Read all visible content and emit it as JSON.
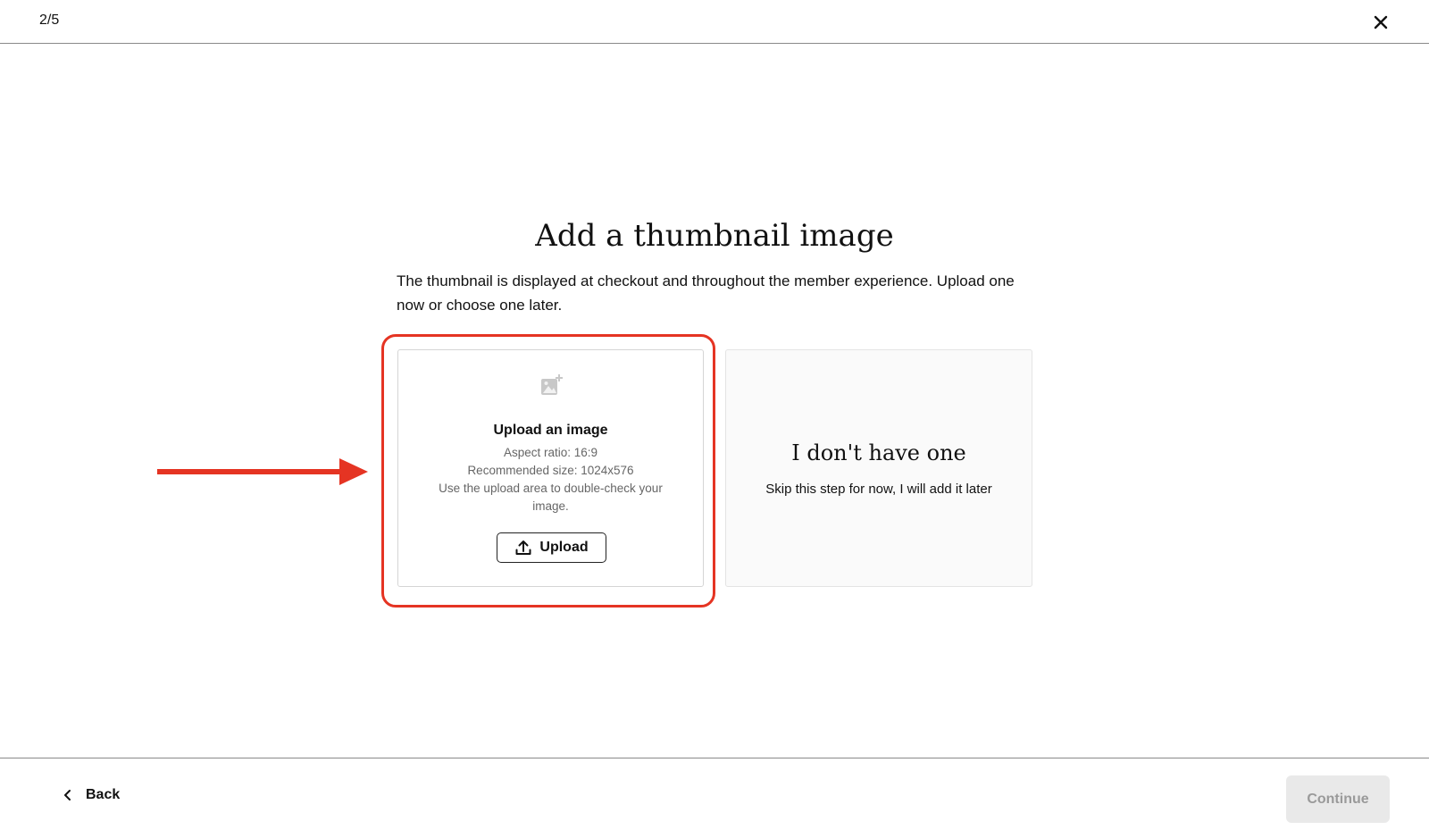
{
  "header": {
    "step_indicator": "2/5",
    "close_icon": "close-icon"
  },
  "main": {
    "title": "Add a thumbnail image",
    "description": "The thumbnail is displayed at checkout and throughout the member experience. Upload one now or choose one later."
  },
  "upload_card": {
    "icon": "image-add-icon",
    "title": "Upload an image",
    "aspect_ratio": "Aspect ratio: 16:9",
    "recommended_size": "Recommended size: 1024x576",
    "hint_line1": "Use the upload area to double-check your",
    "hint_line2": "image.",
    "button_label": "Upload",
    "button_icon": "upload-icon"
  },
  "skip_card": {
    "title": "I don't have one",
    "subtitle": "Skip this step for now, I will add it later"
  },
  "footer": {
    "back_label": "Back",
    "back_icon": "chevron-left-icon",
    "continue_label": "Continue"
  },
  "colors": {
    "highlight": "#e53423",
    "arrow": "#e53423",
    "continue_disabled_bg": "#e9e9e9"
  }
}
